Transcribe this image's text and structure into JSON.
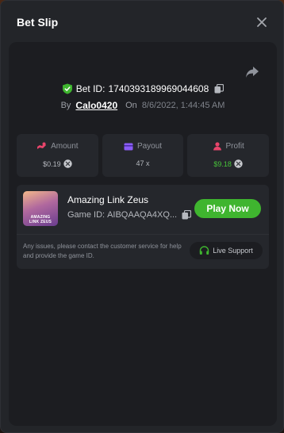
{
  "modal": {
    "title": "Bet Slip"
  },
  "bet": {
    "id_label": "Bet ID:",
    "id": "1740393189969044608",
    "by_label": "By",
    "user": "Calo0420",
    "on_label": "On",
    "date": "8/6/2022, 1:44:45 AM"
  },
  "stats": {
    "amount": {
      "label": "Amount",
      "value": "$0.19"
    },
    "payout": {
      "label": "Payout",
      "value": "47 x"
    },
    "profit": {
      "label": "Profit",
      "value": "$9.18"
    }
  },
  "game": {
    "title": "Amazing Link Zeus",
    "thumb_text_1": "AMAZING",
    "thumb_text_2": "LINK ZEUS",
    "id_label": "Game ID:",
    "id": "AIBQAAQA4XQ...",
    "play_label": "Play Now"
  },
  "support": {
    "notice": "Any issues, please contact the customer service for help and provide the game ID.",
    "button_label": "Live Support"
  },
  "colors": {
    "accent_green": "#3fb52f",
    "profit_green": "#47c23a",
    "amount_icon": "#e8456b",
    "payout_icon": "#8a5cf6",
    "profit_icon": "#e8456b"
  },
  "icons": {
    "close": "close-icon",
    "share": "share-icon",
    "verified": "shield-check-icon",
    "copy": "copy-icon",
    "coin": "coin-icon",
    "support": "headset-icon"
  }
}
